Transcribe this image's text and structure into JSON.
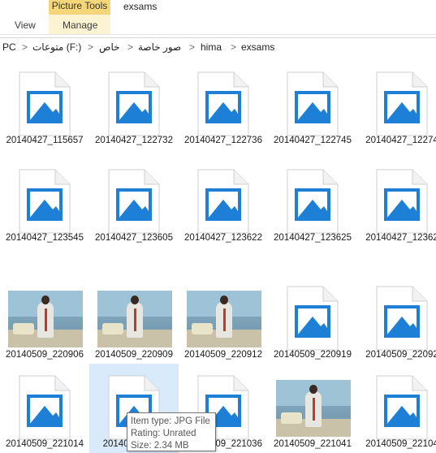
{
  "ribbon": {
    "context_label": "Picture Tools",
    "tabs": [
      {
        "label": "View"
      },
      {
        "label": "Manage"
      }
    ],
    "window_title": "exsams",
    "accent": "#f5d77a"
  },
  "address": {
    "crumbs": [
      {
        "label": "PC"
      },
      {
        "label": "متوعات (F:)"
      },
      {
        "label": "خاص"
      },
      {
        "label": "صور خاصة"
      },
      {
        "label": "hima"
      },
      {
        "label": "exsams"
      }
    ],
    "separator": ">"
  },
  "files": [
    {
      "name": "20140427_115657",
      "kind": "icon"
    },
    {
      "name": "20140427_122732",
      "kind": "icon"
    },
    {
      "name": "20140427_122736",
      "kind": "icon"
    },
    {
      "name": "20140427_122745",
      "kind": "icon"
    },
    {
      "name": "20140427_12274",
      "kind": "icon"
    },
    {
      "name": "20140427_123545",
      "kind": "icon"
    },
    {
      "name": "20140427_123605",
      "kind": "icon"
    },
    {
      "name": "20140427_123622",
      "kind": "icon"
    },
    {
      "name": "20140427_123625",
      "kind": "icon"
    },
    {
      "name": "20140427_12362",
      "kind": "icon"
    },
    {
      "name": "20140509_220906",
      "kind": "photo"
    },
    {
      "name": "20140509_220909",
      "kind": "photo"
    },
    {
      "name": "20140509_220912",
      "kind": "photo"
    },
    {
      "name": "20140509_220919",
      "kind": "icon"
    },
    {
      "name": "20140509_22092",
      "kind": "icon"
    },
    {
      "name": "20140509_221014",
      "kind": "icon"
    },
    {
      "name": "20140509_221",
      "kind": "icon",
      "selected": true
    },
    {
      "name": "20140509_221036",
      "kind": "icon"
    },
    {
      "name": "20140509_221041",
      "kind": "photo"
    },
    {
      "name": "20140509_22104",
      "kind": "icon"
    }
  ],
  "tooltip": {
    "item_type": "Item type: JPG File",
    "rating": "Rating: Unrated",
    "size": "Size: 2.34 MB"
  },
  "icon_color": "#1e7fd6"
}
